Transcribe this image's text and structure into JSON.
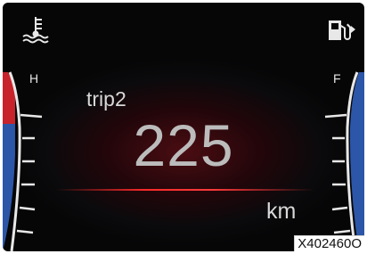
{
  "cluster": {
    "temp_gauge": {
      "high_label": "H",
      "icon": "coolant-temperature-icon",
      "color_hot": "#d42a2a",
      "color_normal": "#2f5fb8"
    },
    "fuel_gauge": {
      "full_label": "F",
      "icon": "fuel-pump-icon",
      "color": "#2f5fb8"
    },
    "trip": {
      "label": "trip2",
      "value": "225",
      "unit": "km"
    }
  },
  "figure_code": "X402460O"
}
